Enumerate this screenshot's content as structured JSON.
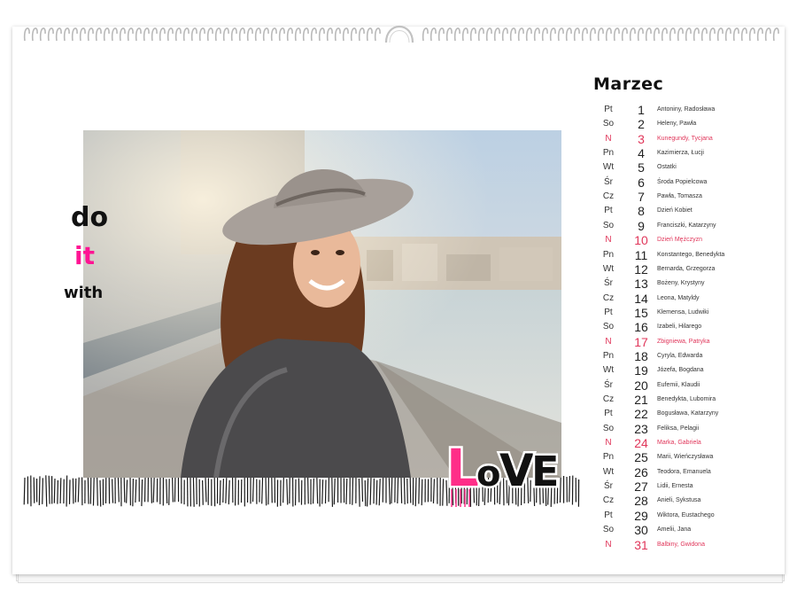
{
  "calendar": {
    "month": "Marzec",
    "days": [
      {
        "day": "Pt",
        "num": "1",
        "names": "Antoniny, Radosława",
        "sunday": false
      },
      {
        "day": "So",
        "num": "2",
        "names": "Heleny, Pawła",
        "sunday": false
      },
      {
        "day": "N",
        "num": "3",
        "names": "Kunegundy, Tycjana",
        "sunday": true
      },
      {
        "day": "Pn",
        "num": "4",
        "names": "Kazimierza, Łucji",
        "sunday": false
      },
      {
        "day": "Wt",
        "num": "5",
        "names": "Ostatki",
        "sunday": false
      },
      {
        "day": "Śr",
        "num": "6",
        "names": "Środa Popielcowa",
        "sunday": false
      },
      {
        "day": "Cz",
        "num": "7",
        "names": "Pawła, Tomasza",
        "sunday": false
      },
      {
        "day": "Pt",
        "num": "8",
        "names": "Dzień Kobiet",
        "sunday": false
      },
      {
        "day": "So",
        "num": "9",
        "names": "Franciszki, Katarzyny",
        "sunday": false
      },
      {
        "day": "N",
        "num": "10",
        "names": "Dzień Mężczyzn",
        "sunday": true
      },
      {
        "day": "Pn",
        "num": "11",
        "names": "Konstantego, Benedykta",
        "sunday": false
      },
      {
        "day": "Wt",
        "num": "12",
        "names": "Bernarda, Grzegorza",
        "sunday": false
      },
      {
        "day": "Śr",
        "num": "13",
        "names": "Bożeny, Krystyny",
        "sunday": false
      },
      {
        "day": "Cz",
        "num": "14",
        "names": "Leona, Matyldy",
        "sunday": false
      },
      {
        "day": "Pt",
        "num": "15",
        "names": "Klemensa, Ludwiki",
        "sunday": false
      },
      {
        "day": "So",
        "num": "16",
        "names": "Izabeli, Hilarego",
        "sunday": false
      },
      {
        "day": "N",
        "num": "17",
        "names": "Zbigniewa, Patryka",
        "sunday": true
      },
      {
        "day": "Pn",
        "num": "18",
        "names": "Cyryla, Edwarda",
        "sunday": false
      },
      {
        "day": "Wt",
        "num": "19",
        "names": "Józefa, Bogdana",
        "sunday": false
      },
      {
        "day": "Śr",
        "num": "20",
        "names": "Eufemii, Klaudii",
        "sunday": false
      },
      {
        "day": "Cz",
        "num": "21",
        "names": "Benedykta, Lubomira",
        "sunday": false
      },
      {
        "day": "Pt",
        "num": "22",
        "names": "Bogusława, Katarzyny",
        "sunday": false
      },
      {
        "day": "So",
        "num": "23",
        "names": "Feliksa, Pelagii",
        "sunday": false
      },
      {
        "day": "N",
        "num": "24",
        "names": "Marka, Gabriela",
        "sunday": true
      },
      {
        "day": "Pn",
        "num": "25",
        "names": "Marii, Wieńczysława",
        "sunday": false
      },
      {
        "day": "Wt",
        "num": "26",
        "names": "Teodora, Emanuela",
        "sunday": false
      },
      {
        "day": "Śr",
        "num": "27",
        "names": "Lidii, Ernesta",
        "sunday": false
      },
      {
        "day": "Cz",
        "num": "28",
        "names": "Anieli, Sykstusa",
        "sunday": false
      },
      {
        "day": "Pt",
        "num": "29",
        "names": "Wiktora, Eustachego",
        "sunday": false
      },
      {
        "day": "So",
        "num": "30",
        "names": "Amelii, Jana",
        "sunday": false
      },
      {
        "day": "N",
        "num": "31",
        "names": "Balbiny, Gwidona",
        "sunday": true
      }
    ]
  },
  "decor": {
    "do": "do",
    "it": "it",
    "with": "with",
    "love": "LoVE"
  },
  "colors": {
    "sunday_red": "#e0365a",
    "accent_pink": "#ff1493",
    "ink": "#111111"
  }
}
